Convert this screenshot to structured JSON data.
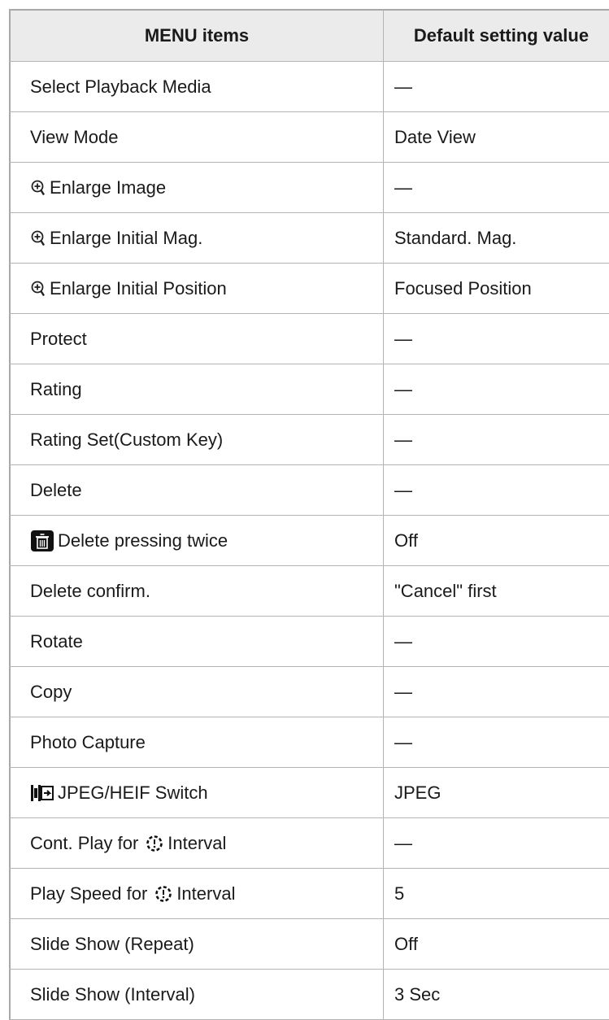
{
  "table": {
    "headers": [
      "MENU items",
      "Default setting value"
    ],
    "rows": [
      {
        "item": "Select Playback Media",
        "value": "—",
        "icon": ""
      },
      {
        "item": "View Mode",
        "value": "Date View",
        "icon": ""
      },
      {
        "item": "Enlarge Image",
        "value": "—",
        "icon": "magnifier-plus-icon"
      },
      {
        "item": "Enlarge Initial Mag.",
        "value": "Standard. Mag.",
        "icon": "magnifier-plus-icon"
      },
      {
        "item": "Enlarge Initial Position",
        "value": "Focused Position",
        "icon": "magnifier-plus-icon"
      },
      {
        "item": "Protect",
        "value": "—",
        "icon": ""
      },
      {
        "item": "Rating",
        "value": "—",
        "icon": ""
      },
      {
        "item": "Rating Set(Custom Key)",
        "value": "—",
        "icon": ""
      },
      {
        "item": "Delete",
        "value": "—",
        "icon": ""
      },
      {
        "item": "Delete pressing twice",
        "value": "Off",
        "icon": "trash-icon"
      },
      {
        "item": "Delete confirm.",
        "value": "\"Cancel\" first",
        "icon": ""
      },
      {
        "item": "Rotate",
        "value": "—",
        "icon": ""
      },
      {
        "item": "Copy",
        "value": "—",
        "icon": ""
      },
      {
        "item": "Photo Capture",
        "value": "—",
        "icon": ""
      },
      {
        "item": "JPEG/HEIF Switch",
        "value": "JPEG",
        "icon": "jpeg-heif-switch-icon"
      },
      {
        "item": "Cont. Play for",
        "item_suffix": "Interval",
        "value": "—",
        "icon": "interval-icon"
      },
      {
        "item": "Play Speed for",
        "item_suffix": "Interval",
        "value": "5",
        "icon": "interval-icon"
      },
      {
        "item": "Slide Show (Repeat)",
        "value": "Off",
        "icon": ""
      },
      {
        "item": "Slide Show (Interval)",
        "value": "3 Sec",
        "icon": ""
      }
    ]
  },
  "colors": {
    "header_bg": "#ebebeb",
    "border": "#b4b4b4",
    "text": "#1a1a1a"
  }
}
